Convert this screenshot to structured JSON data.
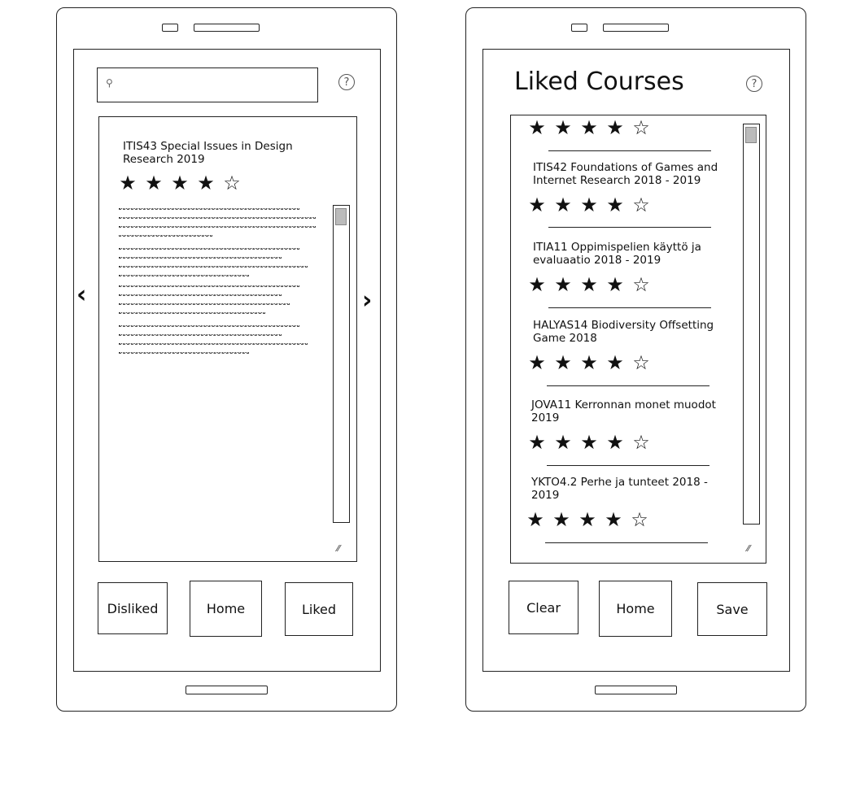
{
  "left_phone": {
    "search": {
      "placeholder": ""
    },
    "course": {
      "title": "ITIS43 Special Issues in Design Research 2019",
      "rating": 4,
      "max_rating": 5
    },
    "buttons": {
      "disliked": "Disliked",
      "home": "Home",
      "liked": "Liked"
    }
  },
  "right_phone": {
    "title": "Liked Courses",
    "top_rating": 4,
    "courses": [
      {
        "title": "ITIS42 Foundations of Games and Internet Research 2018 - 2019",
        "rating": 4
      },
      {
        "title": "ITIA11 Oppimispelien käyttö ja evaluaatio 2018 - 2019",
        "rating": 4
      },
      {
        "title": "HALYAS14 Biodiversity Offsetting Game 2018",
        "rating": 4
      },
      {
        "title": "JOVA11 Kerronnan monet muodot 2019",
        "rating": 4
      },
      {
        "title": "YKTO4.2 Perhe ja tunteet 2018 - 2019",
        "rating": 4
      }
    ],
    "buttons": {
      "clear": "Clear",
      "home": "Home",
      "save": "Save"
    }
  },
  "icons": {
    "search": "search-icon",
    "help": "help-icon",
    "prev": "chevron-left-icon",
    "next": "chevron-right-icon",
    "star": "star-icon",
    "resize": "resize-grip-icon"
  }
}
